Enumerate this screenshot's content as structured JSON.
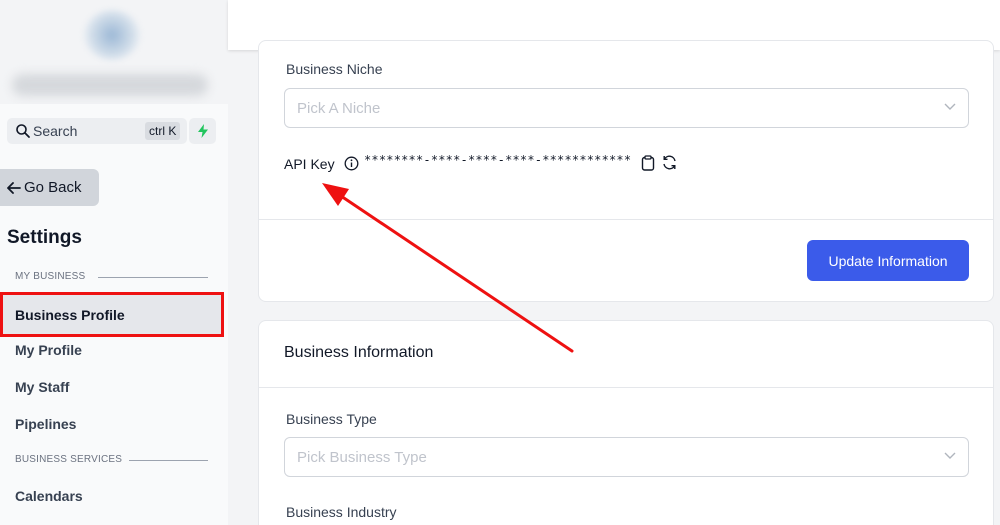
{
  "sidebar": {
    "search": {
      "label": "Search",
      "shortcut": "ctrl K"
    },
    "go_back": "Go Back",
    "settings_title": "Settings",
    "sections": [
      {
        "label": "MY BUSINESS"
      },
      {
        "label": "BUSINESS SERVICES"
      }
    ],
    "items": [
      {
        "label": "Business Profile",
        "active": true
      },
      {
        "label": "My Profile"
      },
      {
        "label": "My Staff"
      },
      {
        "label": "Pipelines"
      },
      {
        "label": "Calendars"
      }
    ]
  },
  "business_card": {
    "niche_label": "Business Niche",
    "niche_placeholder": "Pick A Niche",
    "api_key_label": "API Key",
    "api_key_value": "********-****-****-****-************",
    "update_button": "Update Information"
  },
  "business_info_card": {
    "title": "Business Information",
    "type_label": "Business Type",
    "type_placeholder": "Pick Business Type",
    "industry_label": "Business Industry"
  },
  "colors": {
    "accent": "#3b5bea",
    "highlight": "#ee1111",
    "bolt": "#22c55e"
  }
}
